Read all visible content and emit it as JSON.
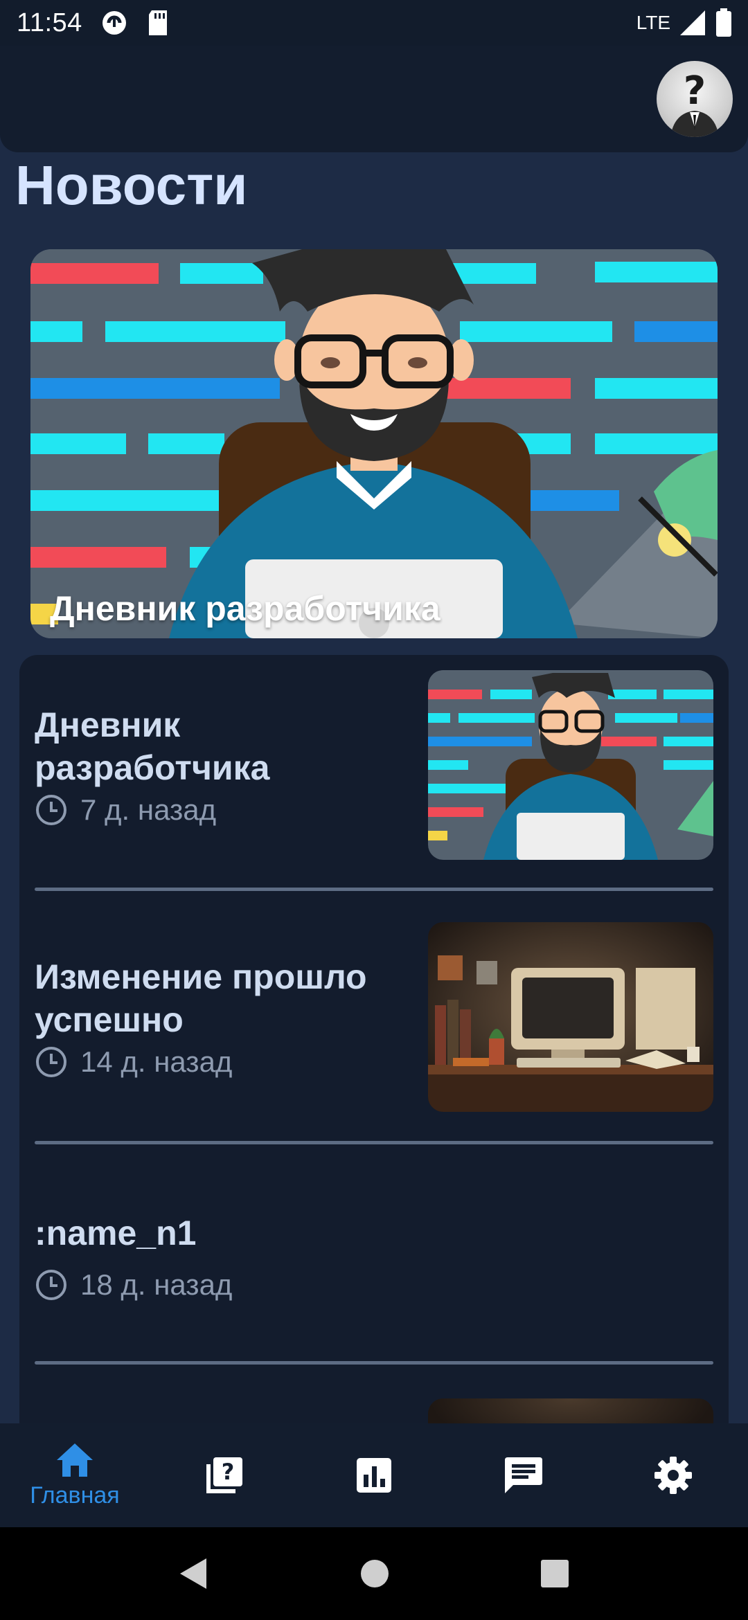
{
  "status_bar": {
    "time": "11:54",
    "network": "LTE",
    "icons": [
      "pocket-icon",
      "sd-card-icon",
      "signal-icon",
      "battery-icon"
    ]
  },
  "header": {
    "avatar": "avatar-question-icon"
  },
  "page": {
    "title": "Новости"
  },
  "featured": {
    "title": "Дневник разработчика"
  },
  "news": [
    {
      "title": "Дневник разработчика",
      "time": "7 д. назад",
      "has_image": true
    },
    {
      "title": "Изменение прошло успешно",
      "time": "14 д. назад",
      "has_image": true
    },
    {
      "title": ":name_n1",
      "time": "18 д. назад",
      "has_image": false
    }
  ],
  "bottom_nav": {
    "items": [
      {
        "icon": "home-icon",
        "label": "Главная",
        "active": true
      },
      {
        "icon": "quiz-icon",
        "label": "",
        "active": false
      },
      {
        "icon": "stats-icon",
        "label": "",
        "active": false
      },
      {
        "icon": "chat-icon",
        "label": "",
        "active": false
      },
      {
        "icon": "settings-icon",
        "label": "",
        "active": false
      }
    ]
  },
  "colors": {
    "background": "#1d2b45",
    "surface": "#131c2d",
    "accent": "#2f8fe6",
    "title": "#d6e4ff",
    "muted": "#8e9bb0"
  }
}
